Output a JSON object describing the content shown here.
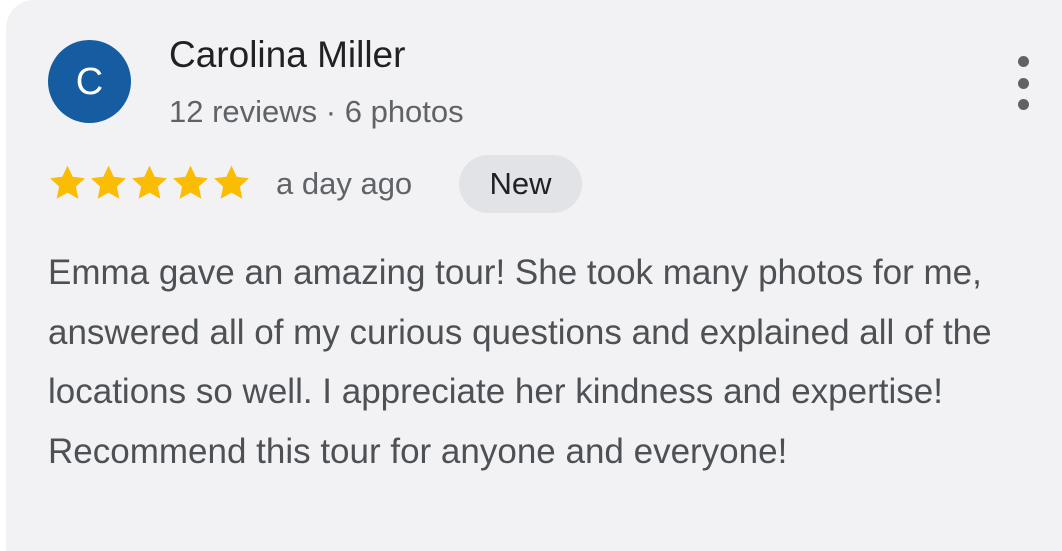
{
  "review": {
    "author": {
      "initial": "C",
      "name": "Carolina Miller",
      "meta": "12 reviews · 6 photos",
      "avatar_color": "#155da0"
    },
    "rating": 5,
    "star_icon": "star-icon",
    "star_color": "#fbbc04",
    "time": "a day ago",
    "badge": "New",
    "text": "Emma gave an amazing tour! She took many photos for me, answered all of my curious questions and explained all of the locations so well. I appreciate her kindness and expertise! Recommend this tour for anyone and everyone!",
    "more_icon": "more-vert-icon"
  }
}
